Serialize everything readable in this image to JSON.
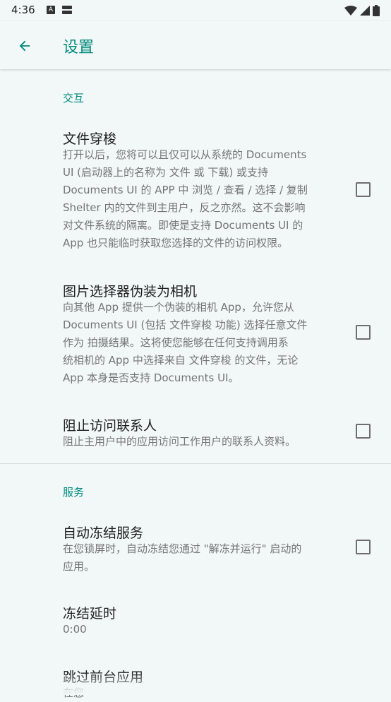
{
  "status_bar": {
    "time": "4:36",
    "a_icon_glyph": "A"
  },
  "app_bar": {
    "title": "设置"
  },
  "sections": {
    "interaction": {
      "header": "交互",
      "file_shuttle": {
        "title": "文件穿梭",
        "summary_lines": [
          "打开以后，您将可以且仅可以从系统的 Documents",
          "UI (启动器上的名称为 文件 或 下载) 或支持",
          "Documents UI 的 APP 中 浏览 / 查看 / 选择 / 复制",
          "Shelter 内的文件到主用户，反之亦然。这不会影响",
          "对文件系统的隔离。即使是支持 Documents UI 的",
          "App 也只能临时获取您选择的文件的访问权限。"
        ]
      },
      "camera_proxy": {
        "title": "图片选择器伪装为相机",
        "summary_lines": [
          "向其他 App 提供一个伪装的相机 App，允许您从",
          "Documents UI (包括 文件穿梭 功能) 选择任意文件",
          "作为 拍摄结果。这将使您能够在任何支持调用系",
          "统相机的 App 中选择来自 文件穿梭 的文件，无论",
          "App 本身是否支持 Documents UI。"
        ]
      },
      "block_contacts": {
        "title": "阻止访问联系人",
        "summary": "阻止主用户中的应用访问工作用户的联系人资料。"
      }
    },
    "services": {
      "header": "服务",
      "auto_freeze": {
        "title": "自动冻结服务",
        "summary_lines": [
          "在您锁屏时，自动冻结您通过 \"解冻并运行\" 启动的",
          "应用。"
        ]
      },
      "freeze_delay": {
        "title": "冻结延时",
        "value": "0:00"
      },
      "skip_foreground": {
        "title": "跳过前台应用",
        "summary_partial": "在您"
      }
    }
  }
}
